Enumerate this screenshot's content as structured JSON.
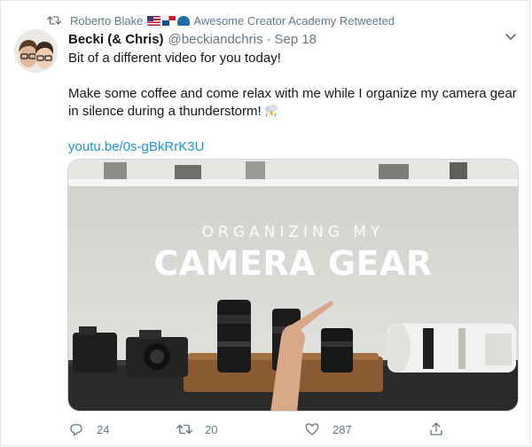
{
  "retweet": {
    "user": "Roberto Blake",
    "suffix": "Awesome Creator Academy Retweeted"
  },
  "tweet": {
    "display_name": "Becki (& Chris)",
    "handle": "@beckiandchris",
    "separator": "·",
    "date": "Sep 18",
    "line1": "Bit of a different video for you today!",
    "line2": "Make some coffee and come relax with me while I organize my camera gear in silence during a thunderstorm!",
    "link": "youtu.be/0s-gBkRrK3U"
  },
  "media": {
    "overlay_small": "ORGANIZING MY",
    "overlay_big": "CAMERA GEAR"
  },
  "actions": {
    "replies": "24",
    "retweets": "20",
    "likes": "287"
  },
  "colors": {
    "accent": "#1b95e0",
    "muted": "#657786",
    "text": "#14171a",
    "border": "#e1e8ed"
  },
  "icons": [
    "retweet-icon",
    "flag-us-icon",
    "flag-panama-icon",
    "cap-icon",
    "chevron-down-icon",
    "thunderstorm-icon",
    "reply-icon",
    "like-icon",
    "share-icon"
  ]
}
